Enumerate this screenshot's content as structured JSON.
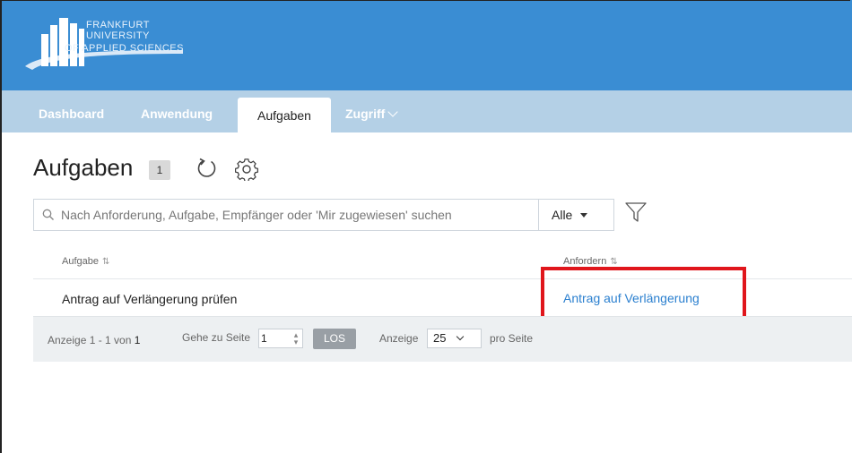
{
  "logo": {
    "line1": "FRANKFURT",
    "line2": "UNIVERSITY",
    "line3": "OF APPLIED SCIENCES"
  },
  "nav": {
    "items": [
      {
        "label": "Dashboard"
      },
      {
        "label": "Anwendung"
      },
      {
        "label": "Aufgaben"
      },
      {
        "label": "Zugriff"
      }
    ]
  },
  "page": {
    "title": "Aufgaben",
    "count": "1"
  },
  "search": {
    "placeholder": "Nach Anforderung, Aufgabe, Empfänger oder 'Mir zugewiesen' suchen",
    "scope": "Alle"
  },
  "table": {
    "columns": [
      "Aufgabe",
      "Anfordern"
    ],
    "sort_icon": "⇅",
    "rows": [
      {
        "task": "Antrag auf Verlängerung prüfen",
        "request": "Antrag auf Verlängerung"
      }
    ]
  },
  "pager": {
    "showing_prefix": "Anzeige 1 - 1 von",
    "total": "1",
    "goto_label": "Gehe zu Seite",
    "page": "1",
    "go_label": "LOS",
    "show_label": "Anzeige",
    "per_page": "25",
    "per_page_suffix": "pro Seite"
  },
  "colors": {
    "header": "#3a8dd3",
    "nav": "#b4d0e6",
    "link": "#2a7fcf",
    "highlight": "#e0161c"
  },
  "icons": [
    "search-icon",
    "refresh-icon",
    "gear-icon",
    "filter-icon",
    "chevron-down-icon",
    "caret-down-icon",
    "sort-icon"
  ]
}
